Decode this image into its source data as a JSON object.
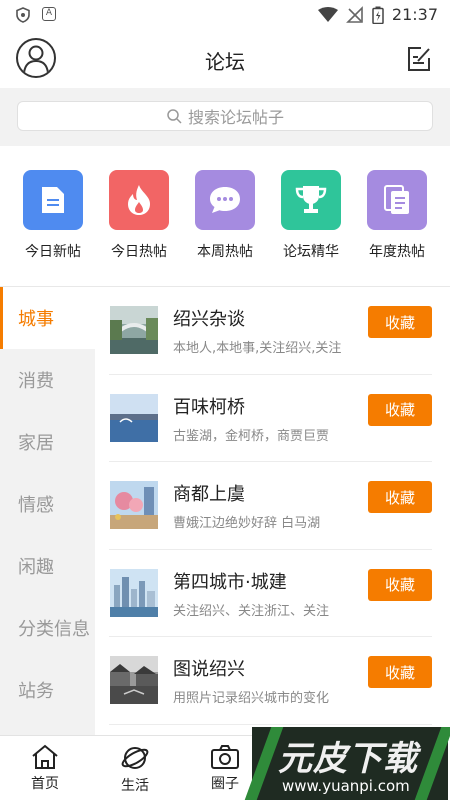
{
  "status_bar": {
    "time": "21:37",
    "left_icon_letter": "A"
  },
  "header": {
    "title": "论坛"
  },
  "search": {
    "placeholder": "搜索论坛帖子"
  },
  "quick_links": [
    {
      "label": "今日新帖",
      "color": "#4f8bf0",
      "icon": "document-icon"
    },
    {
      "label": "今日热帖",
      "color": "#f26565",
      "icon": "flame-icon"
    },
    {
      "label": "本周热帖",
      "color": "#a58be0",
      "icon": "chat-bubble-icon"
    },
    {
      "label": "论坛精华",
      "color": "#2fc59a",
      "icon": "trophy-icon"
    },
    {
      "label": "年度热帖",
      "color": "#a58be0",
      "icon": "documents-icon"
    }
  ],
  "sidebar": {
    "items": [
      {
        "label": "城事",
        "active": true
      },
      {
        "label": "消费",
        "active": false
      },
      {
        "label": "家居",
        "active": false
      },
      {
        "label": "情感",
        "active": false
      },
      {
        "label": "闲趣",
        "active": false
      },
      {
        "label": "分类信息",
        "active": false
      },
      {
        "label": "站务",
        "active": false
      }
    ]
  },
  "forums": [
    {
      "title": "绍兴杂谈",
      "desc": "本地人,本地事,关注绍兴,关注",
      "fav_label": "收藏"
    },
    {
      "title": "百味柯桥",
      "desc": "古鉴湖，金柯桥，商贾巨贾",
      "fav_label": "收藏"
    },
    {
      "title": "商都上虞",
      "desc": "曹娥江边绝妙好辞  白马湖",
      "fav_label": "收藏"
    },
    {
      "title": "第四城市·城建",
      "desc": "关注绍兴、关注浙江、关注",
      "fav_label": "收藏"
    },
    {
      "title": "图说绍兴",
      "desc": "用照片记录绍兴城市的变化",
      "fav_label": "收藏"
    }
  ],
  "tabbar": {
    "tabs": [
      {
        "label": "首页",
        "icon": "home-icon"
      },
      {
        "label": "生活",
        "icon": "planet-icon"
      },
      {
        "label": "圈子",
        "icon": "camera-icon"
      }
    ]
  },
  "watermark": {
    "main": "元皮下载",
    "url": "www.yuanpi.com"
  },
  "colors": {
    "accent": "#f57c00",
    "sidebar_bg": "#f2f2f2"
  }
}
